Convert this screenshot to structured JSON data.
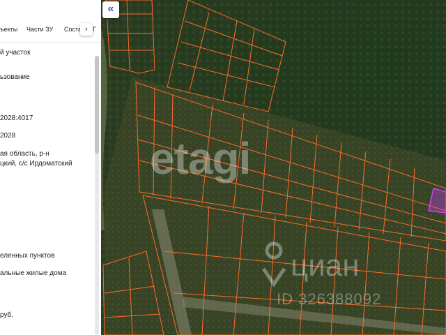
{
  "panel": {
    "tabs": [
      "ъекты",
      "Части ЗУ",
      "Соста",
      "Г"
    ],
    "tab_arrow": "›",
    "rows": [
      "й участок",
      "ьзование",
      "2028:4017",
      "2028",
      "ая область, р-н",
      "цкий, с/с Ирдоматский",
      "еленных пунктов",
      "альные жилые дома",
      "руб."
    ]
  },
  "map": {
    "collapse_label": "«",
    "watermark_brand": "etagi",
    "watermark_cian": "циан",
    "watermark_id": "ID 326388092",
    "colors": {
      "parcel_line": "#ff6a2b",
      "selected_parcel": "#d63cff"
    }
  }
}
